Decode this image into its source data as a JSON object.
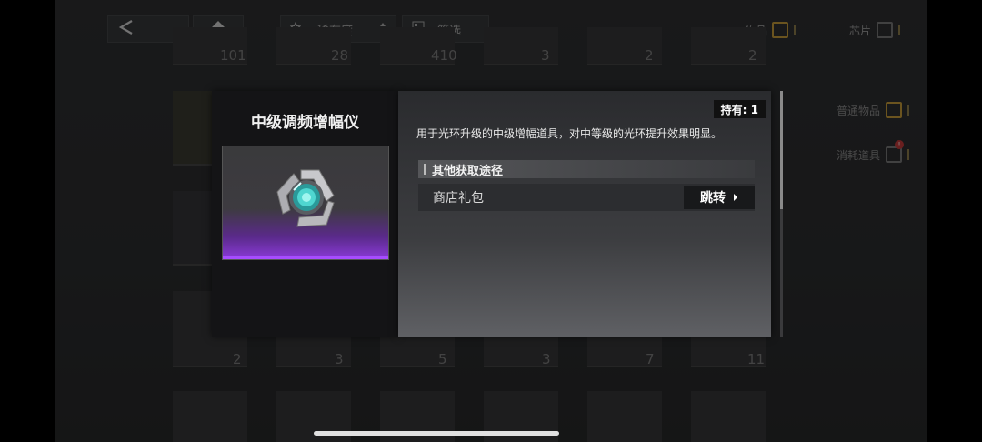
{
  "topbar": {
    "back_icon": "chevron-left-icon",
    "home_icon": "home-icon",
    "rarity_label": "稀有度",
    "filter_label": "筛选",
    "tab_items_label": "物品",
    "tab_chips_label": "芯片"
  },
  "inventory": {
    "top_row_counts": [
      "101",
      "28",
      "410",
      "3",
      "2",
      "2"
    ],
    "bottom_row_counts": [
      "2",
      "3",
      "5",
      "3",
      "7",
      "11"
    ]
  },
  "side_tabs": {
    "normal_items": "普通物品",
    "consumables": "消耗道具",
    "consumables_badge": "!"
  },
  "popup": {
    "item_name": "中级调频增幅仪",
    "owned_text": "持有: 1",
    "description": "用于光环升级的中级增幅道具，对中等级的光环提升效果明显。",
    "section_title": "其他获取途径",
    "sources": [
      {
        "label": "商店礼包",
        "action": "跳转"
      }
    ]
  },
  "colors": {
    "accent_gold": "#c49a3a",
    "rarity_purple": "#8a3ad8"
  }
}
